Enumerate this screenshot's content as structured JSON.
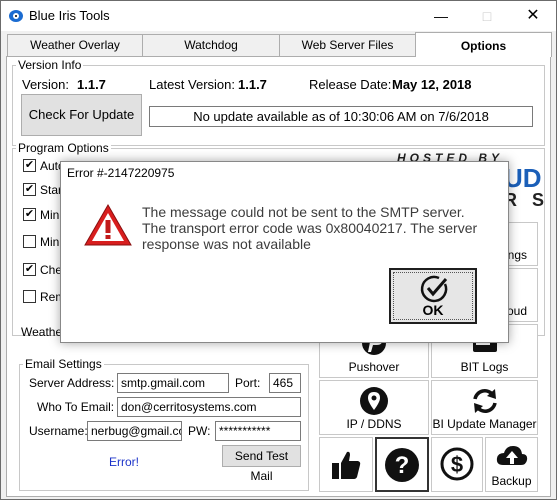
{
  "window": {
    "title": "Blue Iris Tools"
  },
  "tabs": [
    {
      "label": "Weather Overlay"
    },
    {
      "label": "Watchdog"
    },
    {
      "label": "Web Server Files"
    },
    {
      "label": "Options"
    }
  ],
  "version_info": {
    "group_title": "Version Info",
    "version_label": "Version:",
    "version_value": "1.1.7",
    "latest_label": "Latest Version:",
    "latest_value": "1.1.7",
    "release_label": "Release Date:",
    "release_value": "May 12, 2018",
    "check_button": "Check For Update",
    "status": "No update available as of 10:30:06 AM on 7/6/2018"
  },
  "program_options": {
    "group_title": "Program Options",
    "items": [
      {
        "label": "Auto",
        "checked": true
      },
      {
        "label": "Start",
        "checked": true
      },
      {
        "label": "Minim",
        "checked": true
      },
      {
        "label": "Minim",
        "checked": false
      },
      {
        "label": "Chec",
        "checked": true
      },
      {
        "label": "Remo",
        "checked": false
      }
    ],
    "weather_partial": "Weathe"
  },
  "email_settings": {
    "group_title": "Email Settings",
    "server_label": "Server Address:",
    "server_value": "smtp.gmail.com",
    "port_label": "Port:",
    "port_value": "465",
    "to_label": "Who To Email:",
    "to_value": "don@cerritosystems.com",
    "username_label": "Username:",
    "username_value": "nerbug@gmail.com",
    "pw_label": "PW:",
    "pw_value": "***********",
    "error_text": "Error!",
    "send_button": "Send Test Mail"
  },
  "hosted_by": {
    "text": "HOSTED BY",
    "partial_1": "UD",
    "partial_2": "R S"
  },
  "tiles": {
    "ngs_partial": "ngs",
    "oud_partial": "oud",
    "pushover": "Pushover",
    "bit_logs": "BIT Logs",
    "ip_ddns": "IP / DDNS",
    "bi_update_manager": "BI Update Manager",
    "backup": "Backup"
  },
  "dialog": {
    "title": "Error #-2147220975",
    "message": "The message could not be sent to the SMTP server. The transport error code was 0x80040217. The server response was not available",
    "ok_label": "OK"
  },
  "colors": {
    "error_blue": "#1d34c9",
    "warning_red": "#d81e1e"
  }
}
